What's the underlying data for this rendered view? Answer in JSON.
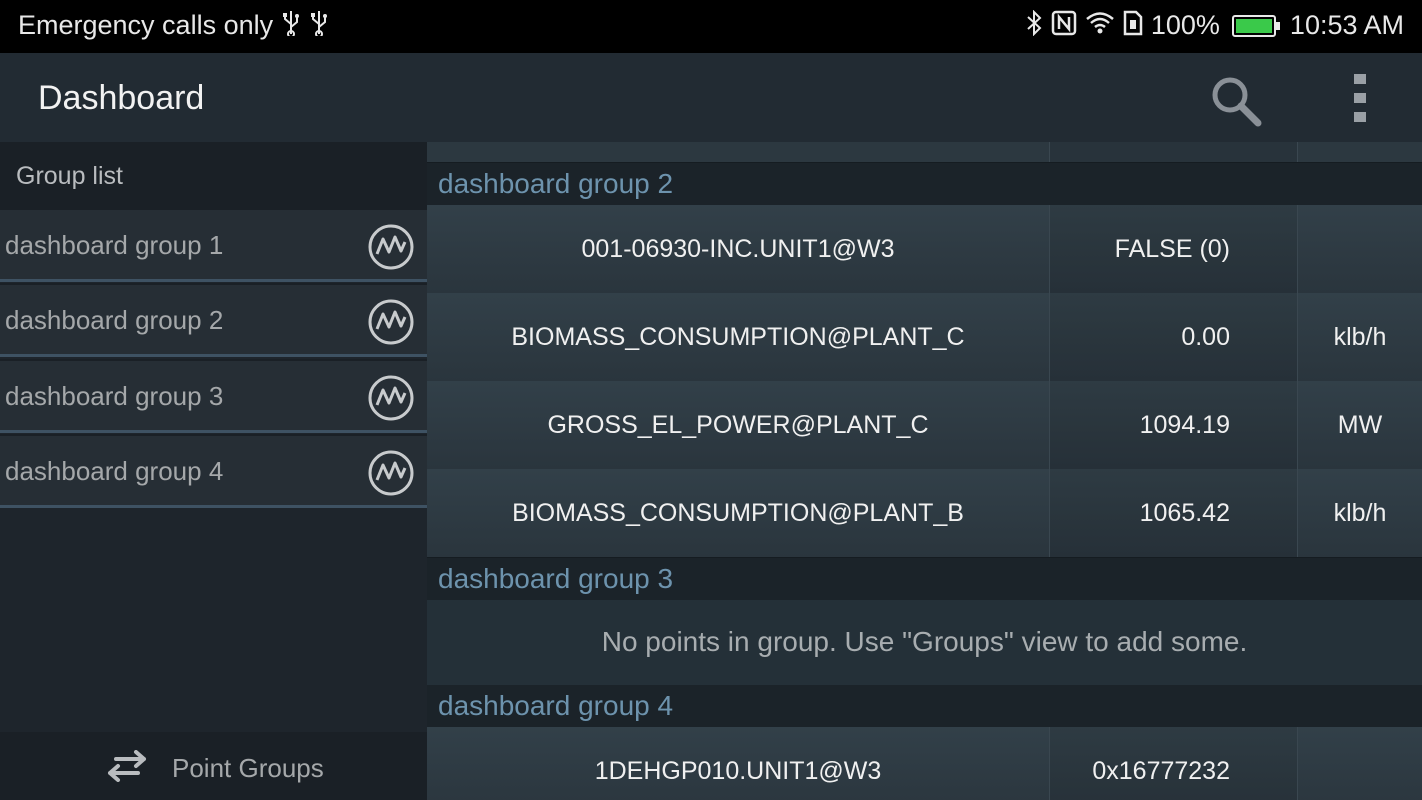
{
  "status_bar": {
    "carrier_text": "Emergency calls only",
    "battery_percent": "100%",
    "time": "10:53 AM",
    "left_icons": [
      "usb-icon",
      "usb-icon"
    ],
    "right_icons": [
      "bluetooth-icon",
      "nfc-icon",
      "wifi-icon",
      "sim-icon",
      "battery-charging-icon"
    ],
    "battery_color": "#3ac94a"
  },
  "app_bar": {
    "title": "Dashboard",
    "actions": [
      "search-icon",
      "overflow-menu-icon"
    ]
  },
  "sidebar": {
    "header": "Group list",
    "items": [
      {
        "label": "dashboard group 1",
        "icon": "trend-chart-icon"
      },
      {
        "label": "dashboard group 2",
        "icon": "trend-chart-icon"
      },
      {
        "label": "dashboard group 3",
        "icon": "trend-chart-icon"
      },
      {
        "label": "dashboard group 4",
        "icon": "trend-chart-icon"
      }
    ],
    "footer": {
      "label": "Point Groups",
      "icon": "swap-arrows-icon"
    }
  },
  "main": {
    "groups": [
      {
        "title": "dashboard group 2",
        "rows": [
          {
            "name": "001-06930-INC.UNIT1@W3",
            "value": "FALSE (0)",
            "unit": ""
          },
          {
            "name": "BIOMASS_CONSUMPTION@PLANT_C",
            "value": "0.00",
            "unit": "klb/h"
          },
          {
            "name": "GROSS_EL_POWER@PLANT_C",
            "value": "1094.19",
            "unit": "MW"
          },
          {
            "name": "BIOMASS_CONSUMPTION@PLANT_B",
            "value": "1065.42",
            "unit": "klb/h"
          }
        ]
      },
      {
        "title": "dashboard group 3",
        "empty_message": "No points in group. Use \"Groups\" view to add some."
      },
      {
        "title": "dashboard group 4",
        "rows": [
          {
            "name": "1DEHGP010.UNIT1@W3",
            "value": "0x16777232",
            "unit": ""
          }
        ]
      }
    ],
    "header_color": "#6d93ad"
  }
}
